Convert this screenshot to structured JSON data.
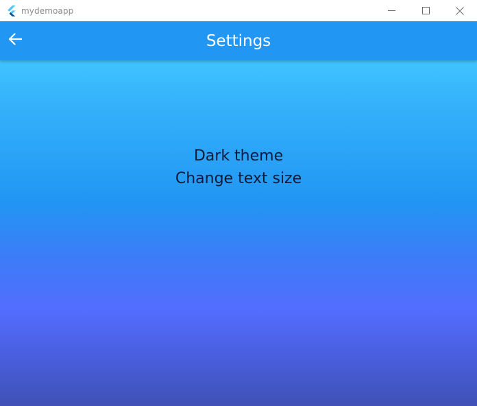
{
  "window": {
    "title": "mydemoapp",
    "controls": [
      "minimize-icon",
      "maximize-icon",
      "close-icon"
    ]
  },
  "appbar": {
    "title": "Settings",
    "back_icon": "arrow-back-icon",
    "color": "#2196f3"
  },
  "menu": {
    "items": [
      {
        "label": "Dark theme"
      },
      {
        "label": "Change text size"
      }
    ]
  },
  "background_gradient": [
    "#40c4ff",
    "#2196f3",
    "#536dfe",
    "#3f51b5"
  ]
}
